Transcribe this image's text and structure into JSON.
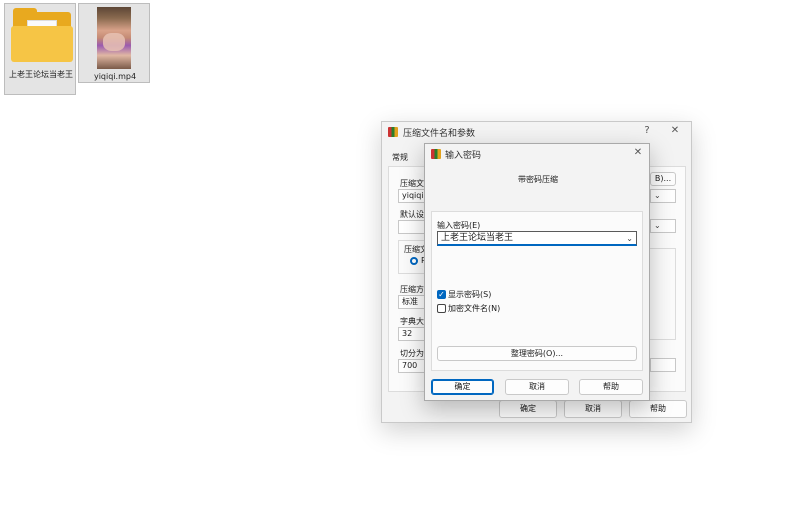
{
  "desktop": {
    "items": [
      {
        "label": "上老王论坛当老王",
        "kind": "folder"
      },
      {
        "label": "yiqiqi.mp4",
        "kind": "video"
      }
    ]
  },
  "back_dialog": {
    "title": "压缩文件名和参数",
    "help_glyph": "?",
    "close_glyph": "✕",
    "tab_general": "常规",
    "archive_label": "压缩文",
    "archive_value": "yiqiqi",
    "browse_suffix": "B)...",
    "profile_label": "默认设",
    "format_group_label": "压缩文",
    "radio_label": "R",
    "method_label": "压缩方",
    "method_value": "标准",
    "dict_label": "字典大",
    "dict_value": "32",
    "split_label": "切分为",
    "split_value": "700",
    "ok": "确定",
    "cancel": "取消",
    "help": "帮助"
  },
  "password_dialog": {
    "title": "输入密码",
    "close_glyph": "✕",
    "heading": "带密码压缩",
    "password_label": "输入密码(E)",
    "password_value": "上老王论坛当老王",
    "show_password": {
      "label": "显示密码(S)",
      "checked": true
    },
    "encrypt_names": {
      "label": "加密文件名(N)",
      "checked": false
    },
    "manage_button": "整理密码(O)...",
    "ok": "确定",
    "cancel": "取消",
    "help": "帮助"
  },
  "icons": {
    "app": "winrar-icon",
    "dropdown": "chevron-down-icon",
    "check": "✓"
  }
}
